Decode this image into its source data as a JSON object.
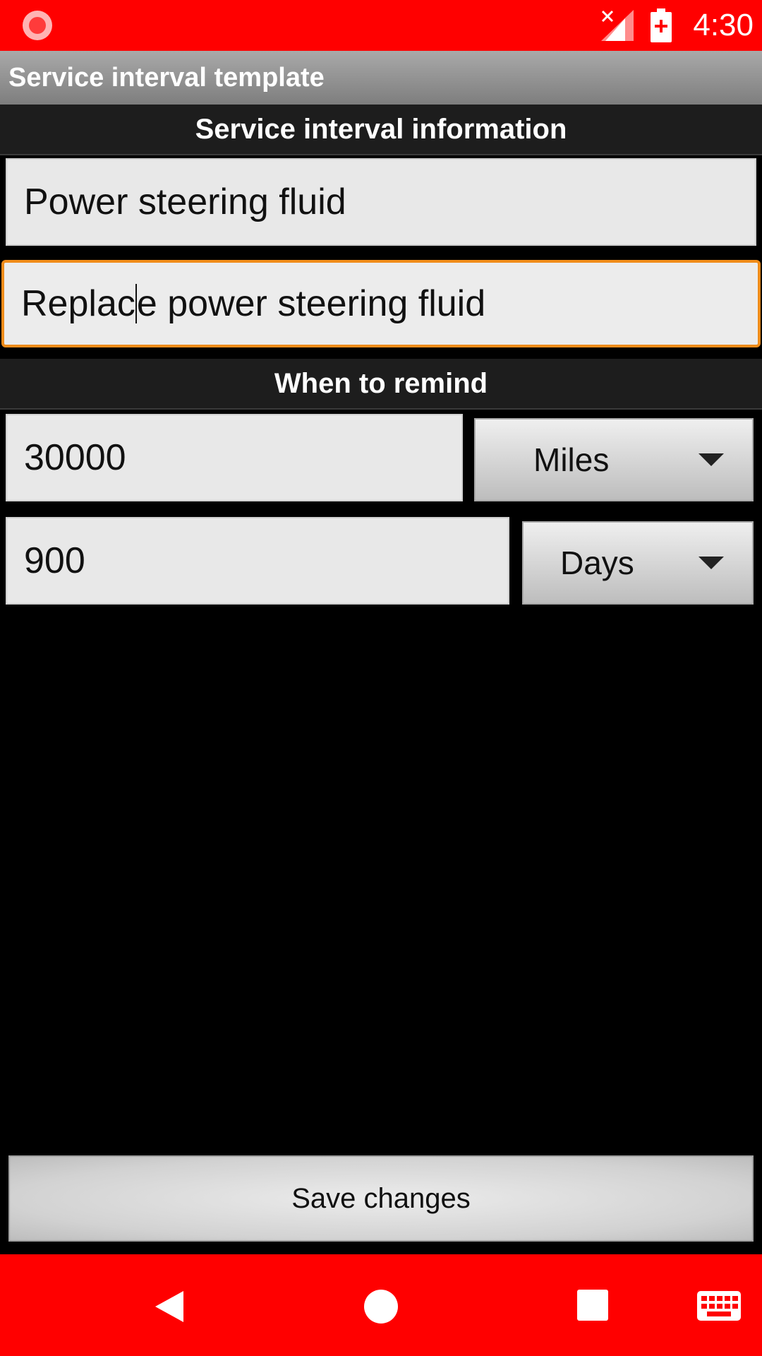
{
  "status_bar": {
    "time": "4:30"
  },
  "app": {
    "title": "Service interval template"
  },
  "sections": {
    "info_header": "Service interval information",
    "remind_header": "When to remind"
  },
  "fields": {
    "name": {
      "value": "Power steering fluid"
    },
    "description": {
      "value_before_caret": "Replac",
      "value_after_caret": "e power steering fluid"
    },
    "distance": {
      "value": "30000"
    },
    "time": {
      "value": "900"
    }
  },
  "units": {
    "distance_unit": "Miles",
    "time_unit": "Days"
  },
  "actions": {
    "save_label": "Save changes"
  },
  "colors": {
    "status_bar": "#ff0000",
    "nav_bar": "#ff0000",
    "focus_border": "#f08c1a",
    "background": "#000000"
  }
}
